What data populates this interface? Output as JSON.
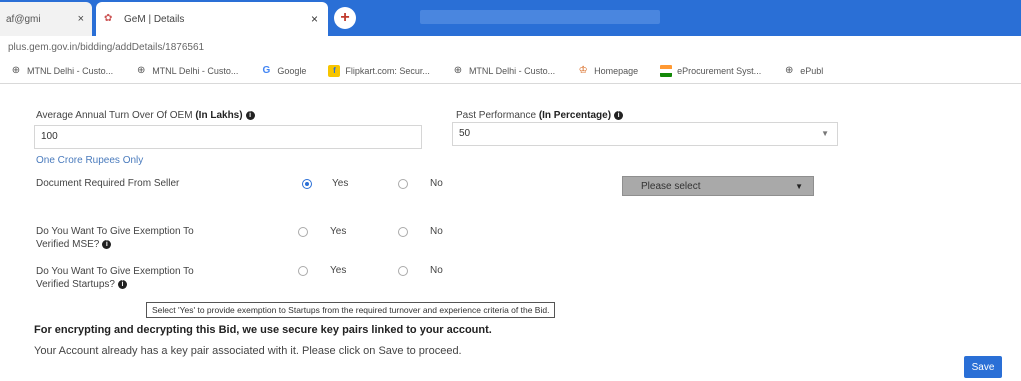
{
  "browser": {
    "tabs": [
      {
        "label": "af@gmi"
      },
      {
        "label": "GeM | Details"
      }
    ],
    "new_tab_symbol": "+",
    "close_symbol": "×",
    "address": "plus.gem.gov.in/bidding/addDetails/1876561",
    "bookmarks": [
      {
        "label": "MTNL Delhi - Custo...",
        "icon": "globe-icon"
      },
      {
        "label": "MTNL Delhi - Custo...",
        "icon": "globe-icon"
      },
      {
        "label": "Google",
        "icon": "google-icon"
      },
      {
        "label": "Flipkart.com: Secur...",
        "icon": "flipkart-icon"
      },
      {
        "label": "MTNL Delhi - Custo...",
        "icon": "globe-icon"
      },
      {
        "label": "Homepage",
        "icon": "homepage-icon"
      },
      {
        "label": "eProcurement Syst...",
        "icon": "flag-icon"
      },
      {
        "label": "ePubl",
        "icon": "globe-icon"
      }
    ]
  },
  "form": {
    "turnover": {
      "label_prefix": "Average Annual Turn Over Of OEM ",
      "label_bold": "(In Lakhs)",
      "value": "100",
      "hint": "One Crore Rupees Only"
    },
    "past_performance": {
      "label_prefix": "Past Performance ",
      "label_bold": "(In Percentage)",
      "value": "50"
    },
    "document_required": {
      "label": "Document Required From Seller",
      "yes": "Yes",
      "no": "No",
      "selected": "Yes",
      "dropdown_value": "Please select"
    },
    "mse_exemption": {
      "label_line1": "Do You Want To Give Exemption To",
      "label_line2": "Verified MSE?",
      "yes": "Yes",
      "no": "No"
    },
    "startup_exemption": {
      "label_line1": "Do You Want To Give Exemption To",
      "label_line2": "Verified Startups?",
      "yes": "Yes",
      "no": "No"
    },
    "tooltip": "Select 'Yes' to provide exemption to Startups from the required turnover and experience criteria of the Bid."
  },
  "notes": {
    "encryption": "For encrypting and decrypting this Bid, we use secure key pairs linked to your account.",
    "keypair": "Your Account already has a key pair associated with it. Please click on Save to proceed."
  },
  "actions": {
    "save_label": "Save"
  },
  "colors": {
    "accent": "#2a6fd6",
    "link": "#4a7bbd",
    "dropdown_bg": "#a9a9a9"
  }
}
